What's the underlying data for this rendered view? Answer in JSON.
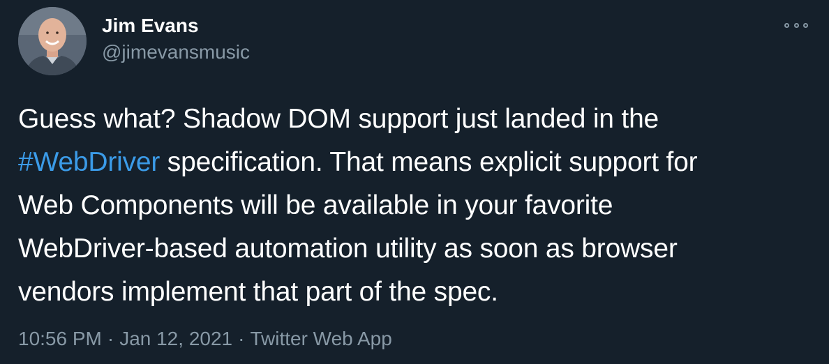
{
  "author": {
    "name": "Jim Evans",
    "handle": "@jimevansmusic"
  },
  "tweet": {
    "line1": "Guess what? Shadow DOM support just landed in the",
    "hashtag": "#WebDriver",
    "line2_rest": " specification. That means explicit support for",
    "line3": "Web Components will be available in your favorite",
    "line4": "WebDriver-based automation utility as soon as browser",
    "line5": "vendors implement that part of the spec."
  },
  "meta": {
    "time": "10:56 PM",
    "separator": "·",
    "date": "Jan 12, 2021",
    "source": "Twitter Web App"
  },
  "icons": {
    "more": "more-options-icon",
    "avatar": "avatar"
  },
  "colors": {
    "background": "#15202b",
    "text": "#ffffff",
    "muted": "#8899a6",
    "link": "#3b9be8"
  }
}
